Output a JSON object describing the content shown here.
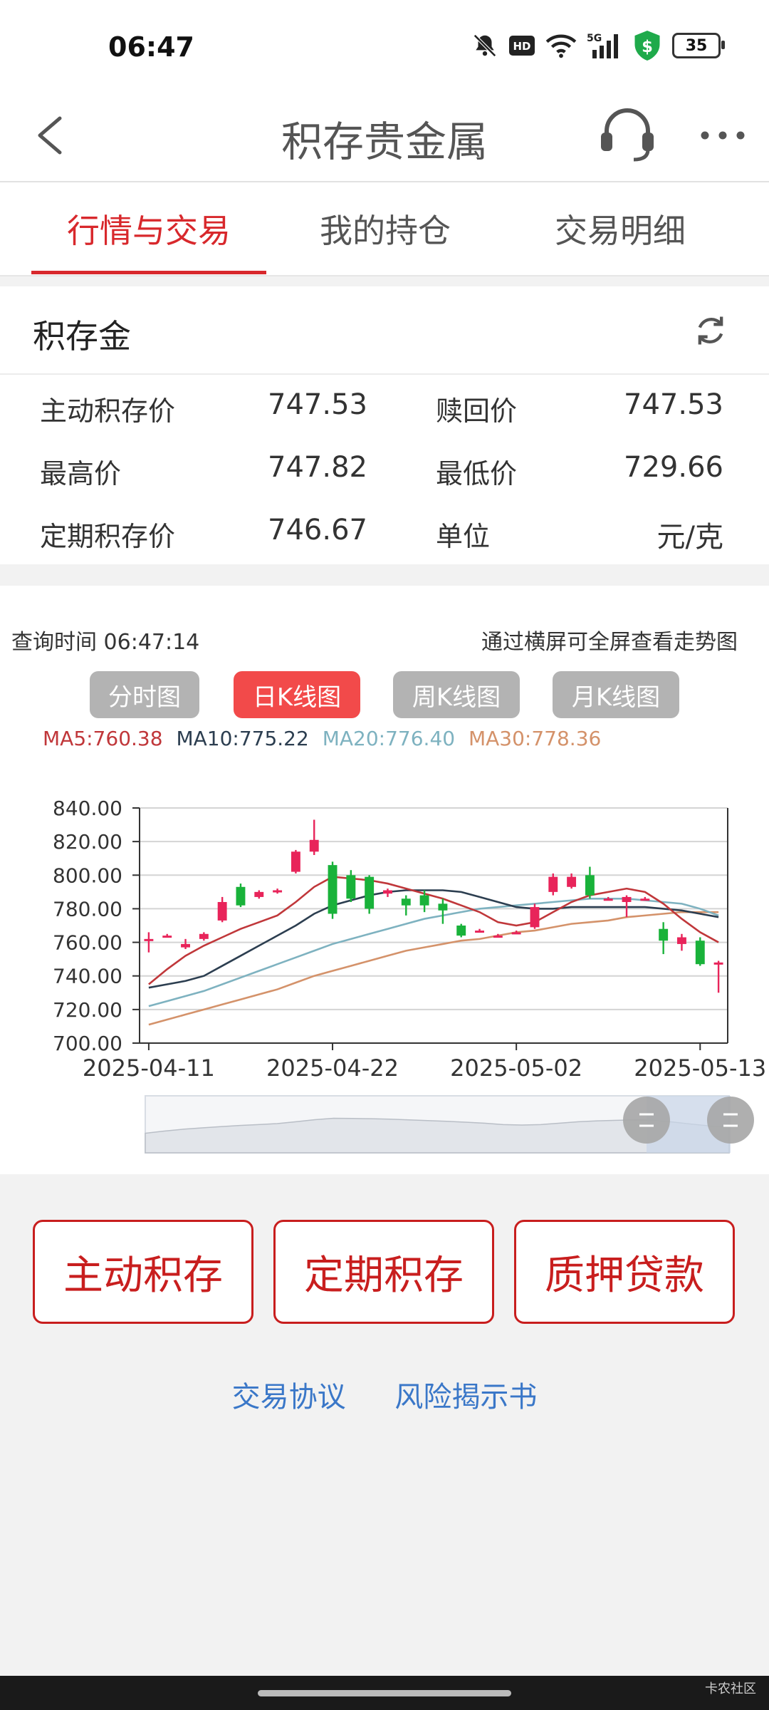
{
  "status": {
    "time": "06:47",
    "battery": "35",
    "hd": "HD",
    "net": "5G"
  },
  "nav": {
    "title": "积存贵金属"
  },
  "tabs": [
    {
      "label": "行情与交易",
      "active": true
    },
    {
      "label": "我的持仓",
      "active": false
    },
    {
      "label": "交易明细",
      "active": false
    }
  ],
  "panel": {
    "title": "积存金",
    "rows": [
      {
        "l1": "主动积存价",
        "v1": "747.53",
        "l2": "赎回价",
        "v2": "747.53"
      },
      {
        "l1": "最高价",
        "v1": "747.82",
        "l2": "最低价",
        "v2": "729.66"
      },
      {
        "l1": "定期积存价",
        "v1": "746.67",
        "l2": "单位",
        "v2": "元/克"
      }
    ]
  },
  "chart": {
    "query_time": "查询时间 06:47:14",
    "hint": "通过横屏可全屏查看走势图",
    "buttons": [
      {
        "label": "分时图",
        "active": false
      },
      {
        "label": "日K线图",
        "active": true
      },
      {
        "label": "周K线图",
        "active": false
      },
      {
        "label": "月K线图",
        "active": false
      }
    ],
    "ma": {
      "ma5": "MA5:760.38",
      "ma10": "MA10:775.22",
      "ma20": "MA20:776.40",
      "ma30": "MA30:778.36"
    },
    "colors": {
      "up": "#e8245a",
      "down": "#19b23a",
      "ma5": "#c0373a",
      "ma10": "#2c3e50",
      "ma20": "#7eb2c0",
      "ma30": "#d4926a"
    }
  },
  "chart_data": {
    "type": "candlestick",
    "ylim": [
      700,
      840
    ],
    "yticks": [
      "840.00",
      "820.00",
      "800.00",
      "780.00",
      "760.00",
      "740.00",
      "720.00",
      "700.00"
    ],
    "xtick_labels": [
      "2025-04-11",
      "2025-04-22",
      "2025-05-02",
      "2025-05-13"
    ],
    "xtick_index": [
      0,
      10,
      20,
      30
    ],
    "candles": [
      {
        "o": 762,
        "c": 762,
        "h": 766,
        "l": 754
      },
      {
        "o": 764,
        "c": 764,
        "h": 765,
        "l": 763
      },
      {
        "o": 757,
        "c": 759,
        "h": 762,
        "l": 756
      },
      {
        "o": 762,
        "c": 765,
        "h": 766,
        "l": 761
      },
      {
        "o": 773,
        "c": 784,
        "h": 787,
        "l": 772
      },
      {
        "o": 793,
        "c": 782,
        "h": 795,
        "l": 781
      },
      {
        "o": 787,
        "c": 790,
        "h": 791,
        "l": 786
      },
      {
        "o": 790,
        "c": 791,
        "h": 792,
        "l": 789
      },
      {
        "o": 802,
        "c": 814,
        "h": 815,
        "l": 801
      },
      {
        "o": 814,
        "c": 821,
        "h": 833,
        "l": 812
      },
      {
        "o": 806,
        "c": 777,
        "h": 808,
        "l": 774
      },
      {
        "o": 800,
        "c": 786,
        "h": 803,
        "l": 784
      },
      {
        "o": 799,
        "c": 780,
        "h": 800,
        "l": 777
      },
      {
        "o": 789,
        "c": 791,
        "h": 792,
        "l": 787
      },
      {
        "o": 786,
        "c": 782,
        "h": 788,
        "l": 776
      },
      {
        "o": 788,
        "c": 782,
        "h": 791,
        "l": 778
      },
      {
        "o": 783,
        "c": 779,
        "h": 786,
        "l": 771
      },
      {
        "o": 770,
        "c": 764,
        "h": 771,
        "l": 763
      },
      {
        "o": 767,
        "c": 767,
        "h": 768,
        "l": 766
      },
      {
        "o": 764,
        "c": 764,
        "h": 765,
        "l": 763
      },
      {
        "o": 766,
        "c": 766,
        "h": 767,
        "l": 765
      },
      {
        "o": 769,
        "c": 781,
        "h": 783,
        "l": 768
      },
      {
        "o": 790,
        "c": 799,
        "h": 801,
        "l": 788
      },
      {
        "o": 793,
        "c": 799,
        "h": 801,
        "l": 792
      },
      {
        "o": 800,
        "c": 788,
        "h": 805,
        "l": 786
      },
      {
        "o": 786,
        "c": 786,
        "h": 787,
        "l": 785
      },
      {
        "o": 784,
        "c": 787,
        "h": 788,
        "l": 775
      },
      {
        "o": 786,
        "c": 786,
        "h": 787,
        "l": 785
      },
      {
        "o": 768,
        "c": 761,
        "h": 772,
        "l": 753
      },
      {
        "o": 759,
        "c": 763,
        "h": 765,
        "l": 755
      },
      {
        "o": 761,
        "c": 747,
        "h": 763,
        "l": 746
      },
      {
        "o": 747,
        "c": 748,
        "h": 749,
        "l": 730
      }
    ],
    "ma5": [
      735,
      744,
      752,
      758,
      763,
      768,
      772,
      776,
      784,
      793,
      799,
      798,
      797,
      795,
      792,
      789,
      786,
      782,
      778,
      772,
      770,
      772,
      778,
      784,
      788,
      790,
      792,
      790,
      783,
      774,
      766,
      760
    ],
    "ma10": [
      733,
      735,
      737,
      740,
      746,
      752,
      758,
      764,
      770,
      777,
      782,
      785,
      788,
      790,
      791,
      791,
      791,
      790,
      787,
      784,
      781,
      780,
      780,
      781,
      781,
      781,
      781,
      781,
      780,
      779,
      777,
      775
    ],
    "ma20": [
      722,
      725,
      728,
      731,
      735,
      739,
      743,
      747,
      751,
      755,
      759,
      762,
      765,
      768,
      771,
      774,
      776,
      778,
      780,
      781,
      782,
      783,
      784,
      785,
      786,
      786,
      786,
      785,
      784,
      783,
      780,
      776
    ],
    "ma30": [
      711,
      714,
      717,
      720,
      723,
      726,
      729,
      732,
      736,
      740,
      743,
      746,
      749,
      752,
      755,
      757,
      759,
      761,
      762,
      764,
      766,
      767,
      769,
      771,
      772,
      773,
      775,
      776,
      777,
      778,
      778,
      778
    ]
  },
  "actions": [
    "主动积存",
    "定期积存",
    "质押贷款"
  ],
  "links": [
    "交易协议",
    "风险揭示书"
  ],
  "footer": {
    "watermark": "卡农社区"
  }
}
